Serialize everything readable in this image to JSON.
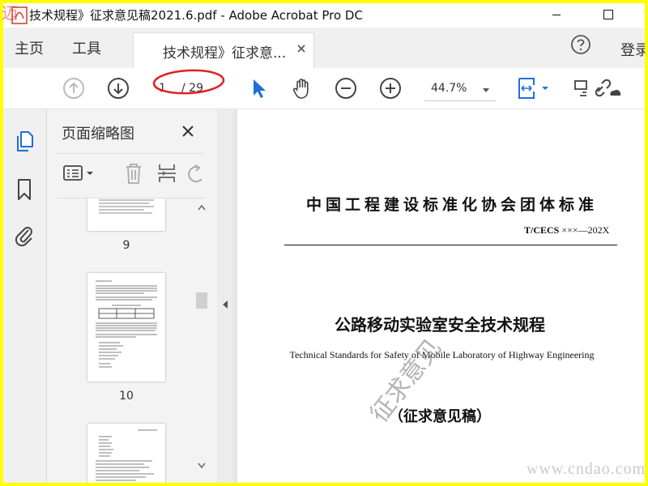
{
  "window": {
    "title": "技术规程》征求意见稿2021.6.pdf - Adobe Acrobat Pro DC",
    "logo_text": "迈"
  },
  "tabs": {
    "home": "主页",
    "tools": "工具",
    "document": "技术规程》征求意...",
    "sign_in": "登录"
  },
  "toolbar": {
    "current_page": "1",
    "total_pages": "/ 29",
    "zoom": "44.7%"
  },
  "thumbnail_panel": {
    "title": "页面缩略图",
    "pages": [
      "9",
      "10"
    ]
  },
  "document": {
    "org_title": "中国工程建设标准化协会团体标准",
    "code_prefix": "T/CECS",
    "code_suffix": "×××—202X",
    "title_cn": "公路移动实验室安全技术规程",
    "title_en": "Technical Standards for Safety of Mobile Laboratory of Highway Engineering",
    "draft_label": "（征求意见稿）",
    "watermark": "征求意见"
  },
  "site_watermark": "www.cndao.com",
  "colors": {
    "frame": "#ffff00",
    "accent_blue": "#1e6fd9",
    "annotation_red": "#e02020"
  }
}
